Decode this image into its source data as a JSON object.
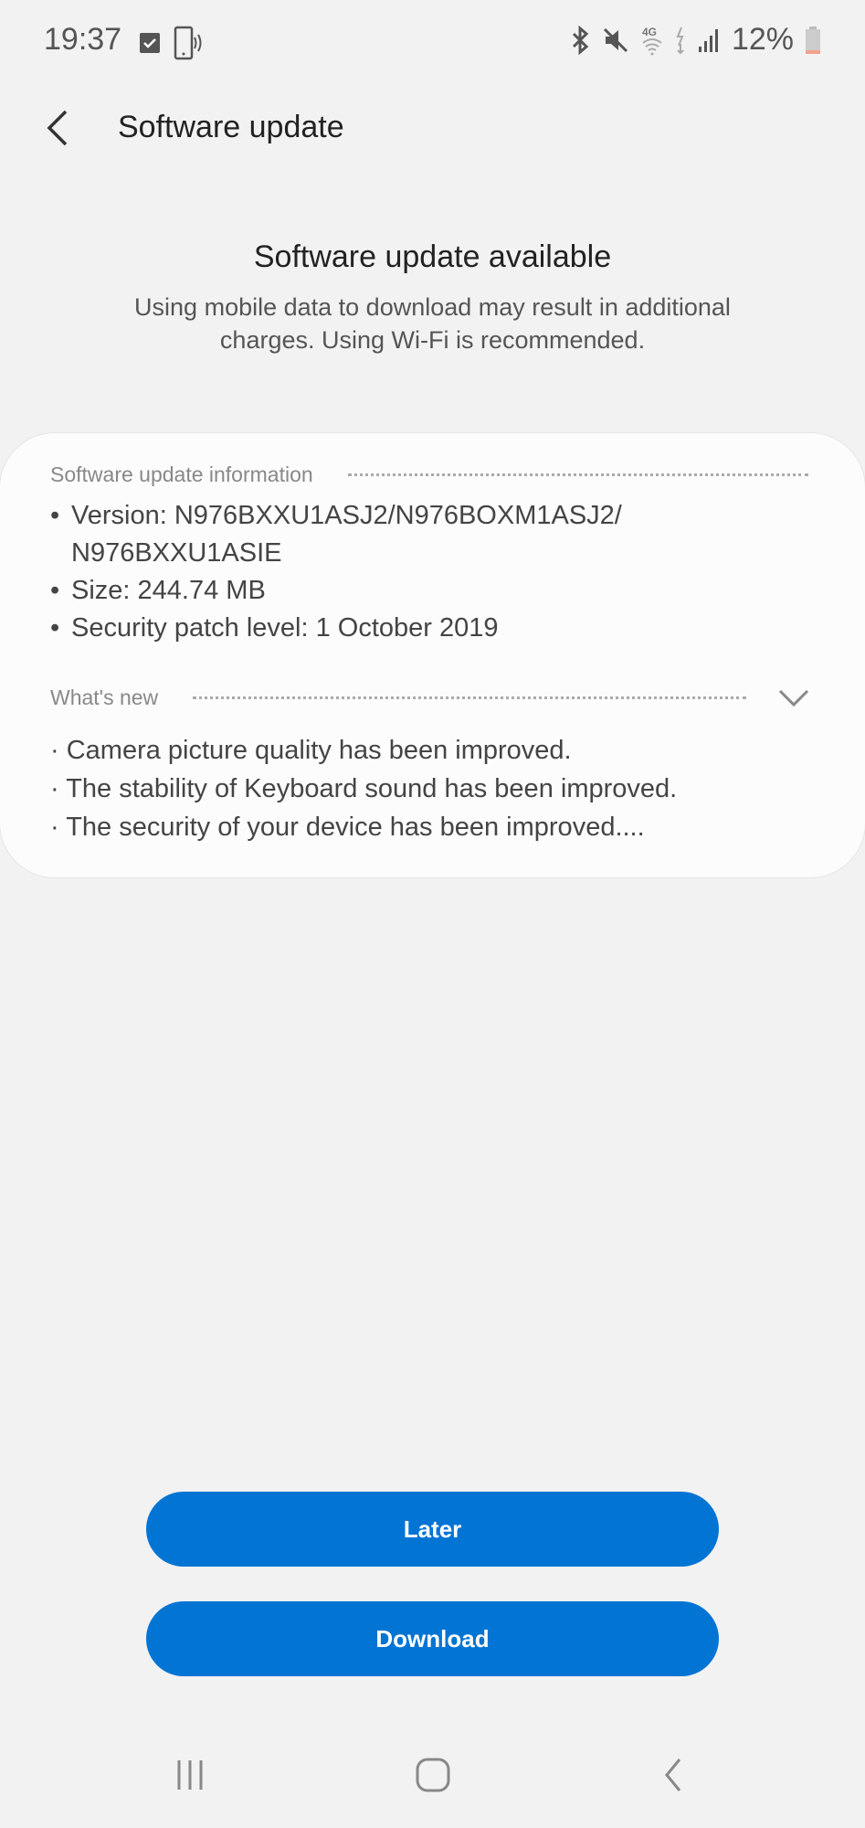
{
  "status_bar": {
    "time": "19:37",
    "battery_percent": "12%",
    "network": "4G",
    "left_icons": [
      "checkbox-notification-icon",
      "phone-nfc-icon"
    ],
    "right_icons": [
      "bluetooth-icon",
      "mute-icon",
      "wifi-4g-icon",
      "data-transfer-icon",
      "signal-icon",
      "battery-icon"
    ],
    "battery_color": "#f4a090"
  },
  "app_bar": {
    "title": "Software update",
    "back_icon": "back-arrow-icon"
  },
  "header": {
    "headline": "Software update available",
    "subtext": "Using mobile data to download may result in additional charges. Using Wi-Fi is recommended."
  },
  "card": {
    "info_heading": "Software update information",
    "info_items": [
      "Version: N976BXXU1ASJ2/N976BOXM1ASJ2/ N976BXXU1ASIE",
      "Size: 244.74 MB",
      "Security patch level: 1 October 2019"
    ],
    "whats_new_heading": "What's new",
    "whats_new_items": [
      "· Camera picture quality has been improved.",
      "· The stability of Keyboard sound has been improved.",
      "· The security of your device has been improved...."
    ]
  },
  "buttons": {
    "later": "Later",
    "download": "Download",
    "color": "#0274d4"
  },
  "nav_bar": {
    "items": [
      "recent-apps-icon",
      "home-icon",
      "back-icon"
    ]
  }
}
